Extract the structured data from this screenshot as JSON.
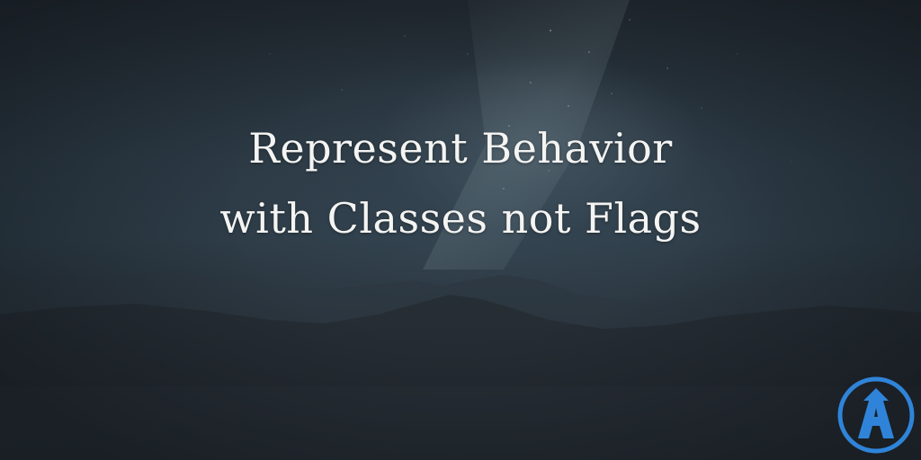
{
  "title": {
    "line1": "Represent Behavior",
    "line2": "with Classes not Flags"
  },
  "logo": {
    "icon": "ardalis-a-logo-icon",
    "color": "#2f84d9"
  },
  "colors": {
    "background": "#2a3138",
    "text": "#f4f4f2",
    "mountains": "#232a31"
  }
}
